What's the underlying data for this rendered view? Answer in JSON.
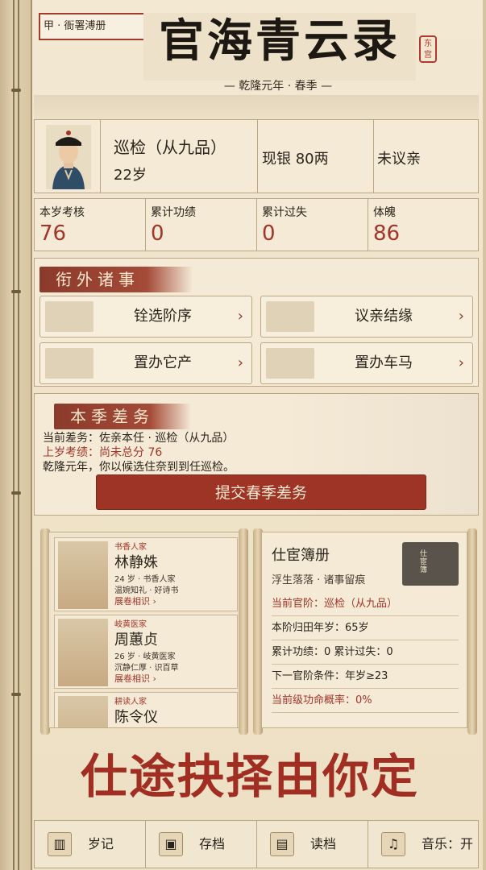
{
  "header": {
    "tag": "甲 · 衙署溥册",
    "title": "官海青云录",
    "seal": "东宫",
    "subtitle": "— 乾隆元年 · 春季 —"
  },
  "player": {
    "rank": "巡检（从九品）",
    "age": "22岁",
    "silver": "现银 80两",
    "marriage": "未议亲"
  },
  "stats": [
    {
      "label": "本岁考核",
      "value": "76"
    },
    {
      "label": "累计功绩",
      "value": "0"
    },
    {
      "label": "累计过失",
      "value": "0"
    },
    {
      "label": "体魄",
      "value": "86"
    }
  ],
  "affairs": {
    "heading": "衔外诸事",
    "buttons": [
      {
        "label": "铨选阶序",
        "icon": "books-icon"
      },
      {
        "label": "议亲结缘",
        "icon": "knot-icon"
      },
      {
        "label": "置办它产",
        "icon": "house-icon"
      },
      {
        "label": "置办车马",
        "icon": "carriage-icon"
      }
    ]
  },
  "season": {
    "heading": "本季差务",
    "current_duty": "当前差务：佐亲本任 · 巡检（从九品）",
    "last_review": "上岁考绩：尚未总分 76",
    "event": "乾隆元年，你以候选住奈到到任巡检。",
    "submit": "提交春季差务"
  },
  "spouses": [
    {
      "tag": "书香人家",
      "name": "林静姝",
      "meta": "24 岁 · 书香人家",
      "traits": "温婉知礼 · 好诗书",
      "more": "展卷相识 ›"
    },
    {
      "tag": "岐黄医家",
      "name": "周蕙贞",
      "meta": "26 岁 · 岐黄医家",
      "traits": "沉静仁厚 · 识百草",
      "more": "展卷相识 ›"
    },
    {
      "tag": "耕读人家",
      "name": "陈令仪",
      "meta": "",
      "traits": "",
      "more": ""
    }
  ],
  "register": {
    "title": "仕宦簿册",
    "book_label": "仕宦簿",
    "subtitle": "浮生落落 · 诸事留痕",
    "lines": [
      {
        "text": "当前官阶：巡检（从九品）",
        "accent": true
      },
      {
        "text": "本阶归田年岁：65岁",
        "accent": false
      },
      {
        "text": "累计功绩：0  累计过失：0",
        "accent": false
      },
      {
        "text": "下一官阶条件：年岁≥23",
        "accent": false
      },
      {
        "text": "当前级功命概率：0%",
        "accent": true
      }
    ]
  },
  "slogan": "仕途抉择由你定",
  "bottom": [
    {
      "label": "岁记",
      "icon": "scroll-icon",
      "glyph": "▥"
    },
    {
      "label": "存档",
      "icon": "chest-icon",
      "glyph": "▣"
    },
    {
      "label": "读档",
      "icon": "book-icon",
      "glyph": "▤"
    },
    {
      "label": "音乐：开",
      "icon": "music-icon",
      "glyph": "♫"
    }
  ],
  "colors": {
    "accent_red": "#a2342a",
    "paper": "#efe3cc",
    "border": "#b9a684"
  }
}
